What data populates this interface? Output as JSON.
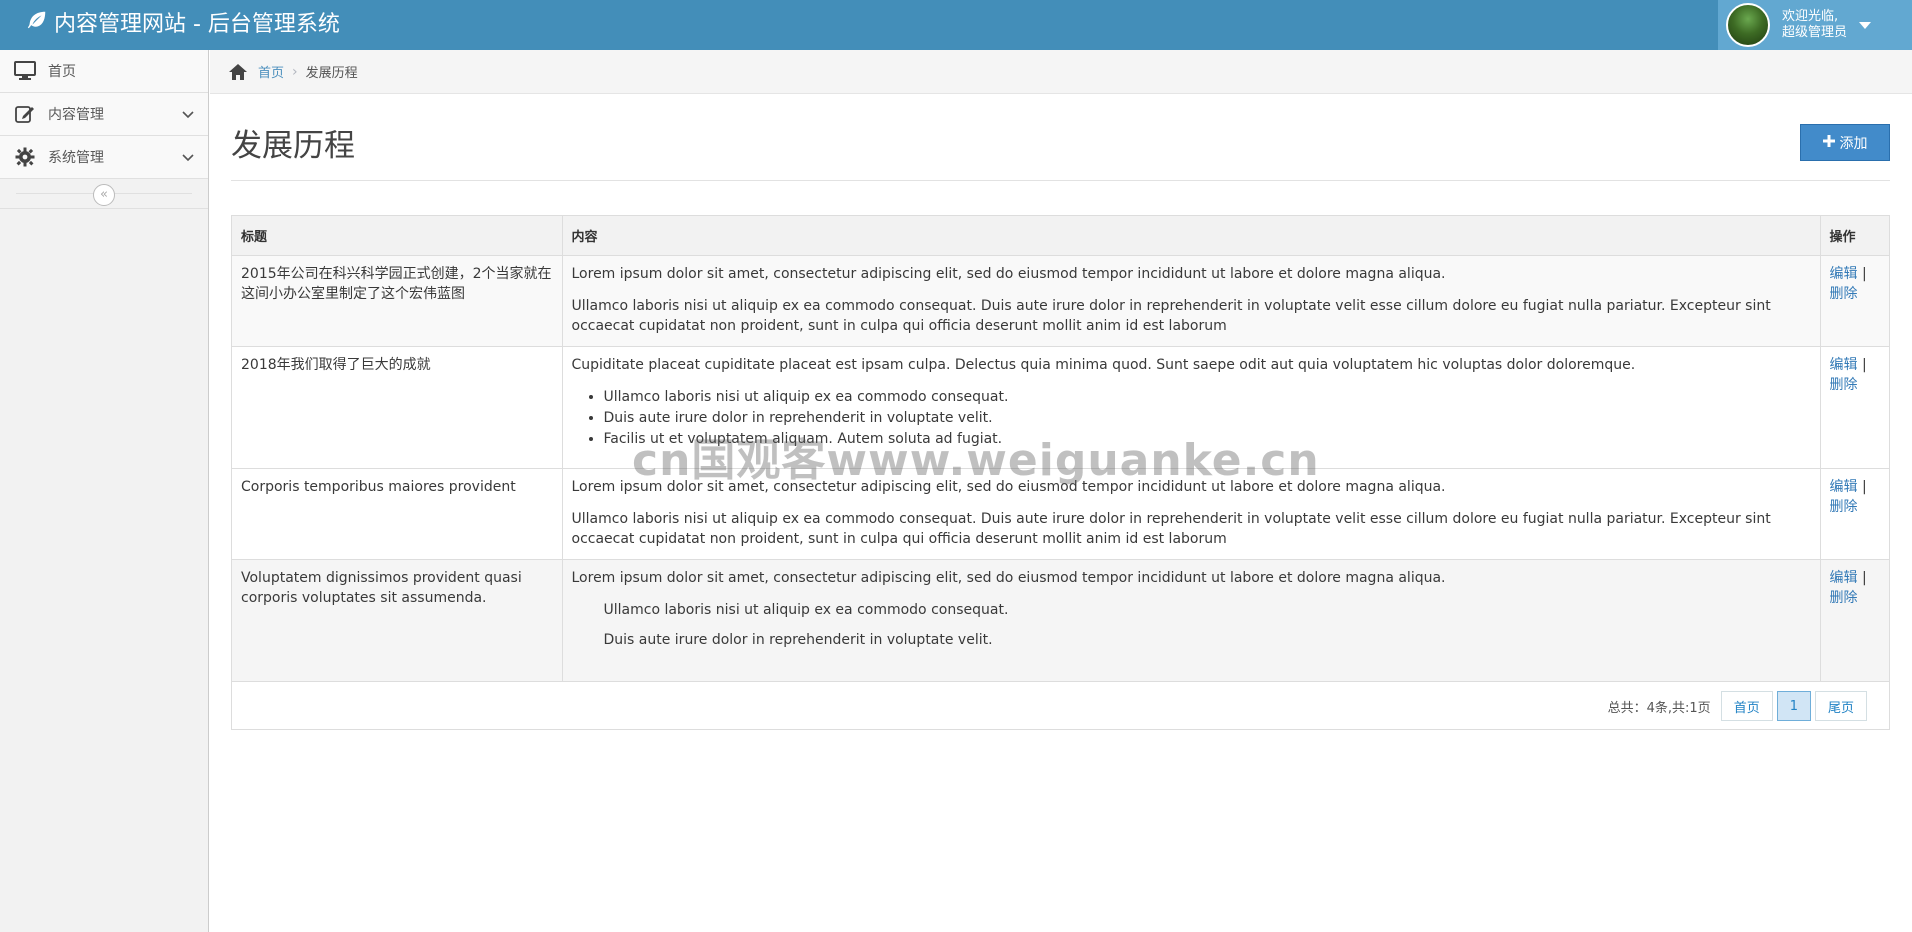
{
  "header": {
    "brand": "内容管理网站 - 后台管理系统",
    "user_welcome": "欢迎光临,",
    "user_role": "超级管理员"
  },
  "sidebar": {
    "items": [
      {
        "label": "首页",
        "icon": "desktop-icon"
      },
      {
        "label": "内容管理",
        "icon": "edit-icon"
      },
      {
        "label": "系统管理",
        "icon": "gear-icon"
      }
    ],
    "collapse_glyph": "«"
  },
  "breadcrumb": {
    "home": "首页",
    "current": "发展历程"
  },
  "page": {
    "title": "发展历程",
    "add_label": "添加"
  },
  "table": {
    "headers": [
      "标题",
      "内容",
      "操作"
    ],
    "rows": [
      {
        "title": "2015年公司在科兴科学园正式创建，2个当家就在这间小办公室里制定了这个宏伟蓝图",
        "p1": "Lorem ipsum dolor sit amet, consectetur adipiscing elit, sed do eiusmod tempor incididunt ut labore et dolore magna aliqua.",
        "p2": "Ullamco laboris nisi ut aliquip ex ea commodo consequat. Duis aute irure dolor in reprehenderit in voluptate velit esse cillum dolore eu fugiat nulla pariatur. Excepteur sint occaecat cupidatat non proident, sunt in culpa qui officia deserunt mollit anim id est laborum"
      },
      {
        "title": "2018年我们取得了巨大的成就",
        "p1": "Cupiditate placeat cupiditate placeat est ipsam culpa. Delectus quia minima quod. Sunt saepe odit aut quia voluptatem hic voluptas dolor doloremque.",
        "li1": "Ullamco laboris nisi ut aliquip ex ea commodo consequat.",
        "li2": "Duis aute irure dolor in reprehenderit in voluptate velit.",
        "li3": "Facilis ut et voluptatem aliquam. Autem soluta ad fugiat."
      },
      {
        "title": "Corporis temporibus maiores provident",
        "p1": "Lorem ipsum dolor sit amet, consectetur adipiscing elit, sed do eiusmod tempor incididunt ut labore et dolore magna aliqua.",
        "p2": "Ullamco laboris nisi ut aliquip ex ea commodo consequat. Duis aute irure dolor in reprehenderit in voluptate velit esse cillum dolore eu fugiat nulla pariatur. Excepteur sint occaecat cupidatat non proident, sunt in culpa qui officia deserunt mollit anim id est laborum"
      },
      {
        "title": "Voluptatem dignissimos provident quasi corporis voluptates sit assumenda.",
        "p1": "Lorem ipsum dolor sit amet, consectetur adipiscing elit, sed do eiusmod tempor incididunt ut labore et dolore magna aliqua.",
        "q1": "Ullamco laboris nisi ut aliquip ex ea commodo consequat.",
        "q2": "Duis aute irure dolor in reprehenderit in voluptate velit."
      }
    ],
    "edit_label": "编辑",
    "op_sep": "|",
    "delete_label": "删除"
  },
  "pagination": {
    "total_text": "总共：4条,共:1页",
    "first_label": "首页",
    "current_page": "1",
    "last_label": "尾页"
  },
  "watermark": "cn国观客www.weiguanke.cn",
  "colors": {
    "header_bg": "#438eb9",
    "user_box_bg": "#62a8d1",
    "add_button": "#428bca",
    "link": "#337ab7"
  }
}
